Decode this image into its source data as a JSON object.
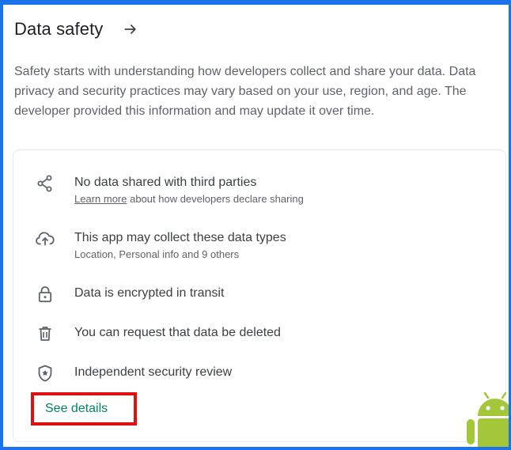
{
  "section": {
    "title": "Data safety",
    "description": "Safety starts with understanding how developers collect and share your data. Data privacy and security practices may vary based on your use, region, and age. The developer provided this information and may update it over time."
  },
  "items": [
    {
      "icon": "share-icon",
      "primary": "No data shared with third parties",
      "secondary_link": "Learn more",
      "secondary": " about how developers declare sharing"
    },
    {
      "icon": "cloud-upload-icon",
      "primary": "This app may collect these data types",
      "secondary": "Location, Personal info and 9 others"
    },
    {
      "icon": "lock-icon",
      "primary": "Data is encrypted in transit"
    },
    {
      "icon": "trash-icon",
      "primary": "You can request that data be deleted"
    },
    {
      "icon": "shield-star-icon",
      "primary": "Independent security review"
    }
  ],
  "see_details_label": "See details",
  "colors": {
    "frame": "#1a73e8",
    "highlight": "#e01010",
    "link_green": "#01875f",
    "android_green": "#a4c639"
  }
}
